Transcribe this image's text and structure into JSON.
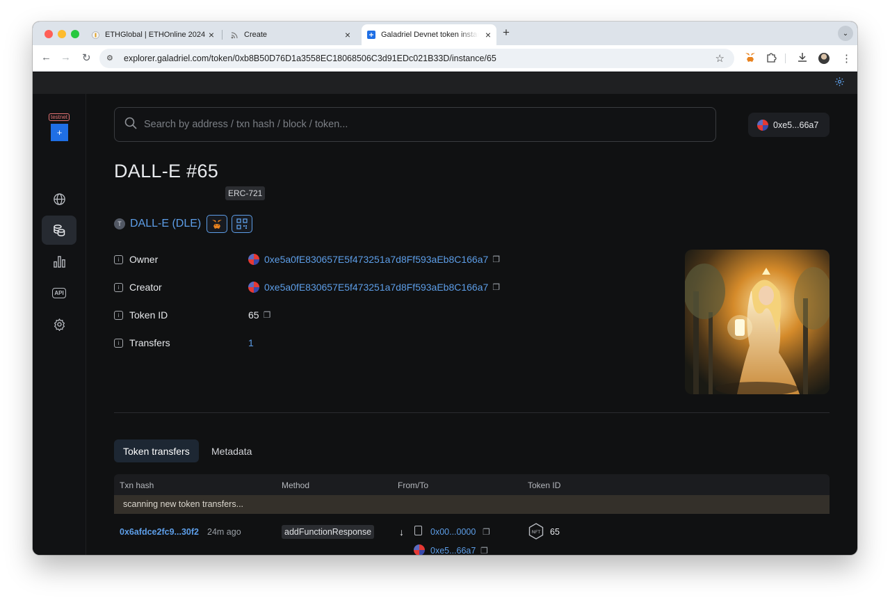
{
  "browser": {
    "tabs": [
      {
        "title": "ETHGlobal | ETHOnline 2024",
        "favicon": "ethglobal-icon"
      },
      {
        "title": "Create",
        "favicon": "rss-icon"
      },
      {
        "title": "Galadriel Devnet token instan",
        "favicon": "galadriel-icon",
        "active": true
      }
    ],
    "url": "explorer.galadriel.com/token/0xb8B50D76D1a3558EC18068506C3d91EDc021B33D/instance/65"
  },
  "sidebar": {
    "badge": "testnet",
    "items": [
      {
        "name": "globe-icon"
      },
      {
        "name": "tokens-icon",
        "active": true
      },
      {
        "name": "charts-icon"
      },
      {
        "name": "API"
      },
      {
        "name": "settings-icon"
      }
    ]
  },
  "search": {
    "placeholder": "Search by address / txn hash / block / token..."
  },
  "account": {
    "short_address": "0xe5...66a7"
  },
  "token": {
    "title": "DALL-E #65",
    "standard": "ERC-721",
    "collection_initial": "T",
    "collection": "DALL-E (DLE)"
  },
  "properties": {
    "owner_label": "Owner",
    "owner": "0xe5a0fE830657E5f473251a7d8Ff593aEb8C166a7",
    "creator_label": "Creator",
    "creator": "0xe5a0fE830657E5f473251a7d8Ff593aEb8C166a7",
    "token_id_label": "Token ID",
    "token_id": "65",
    "transfers_label": "Transfers",
    "transfers": "1"
  },
  "tabs": {
    "transfers": "Token transfers",
    "metadata": "Metadata"
  },
  "table": {
    "headers": {
      "txn_hash": "Txn hash",
      "method": "Method",
      "from_to": "From/To",
      "token_id": "Token ID"
    },
    "scanning": "scanning new token transfers...",
    "rows": [
      {
        "hash": "0x6afdce2fc9...30f2",
        "age": "24m ago",
        "method": "addFunctionResponse",
        "from": "0x00...0000",
        "to": "0xe5...66a7",
        "token_id": "65"
      }
    ]
  },
  "colors": {
    "accent": "#5d9ee8",
    "background": "#101112",
    "brand": "#1f6fe5"
  }
}
